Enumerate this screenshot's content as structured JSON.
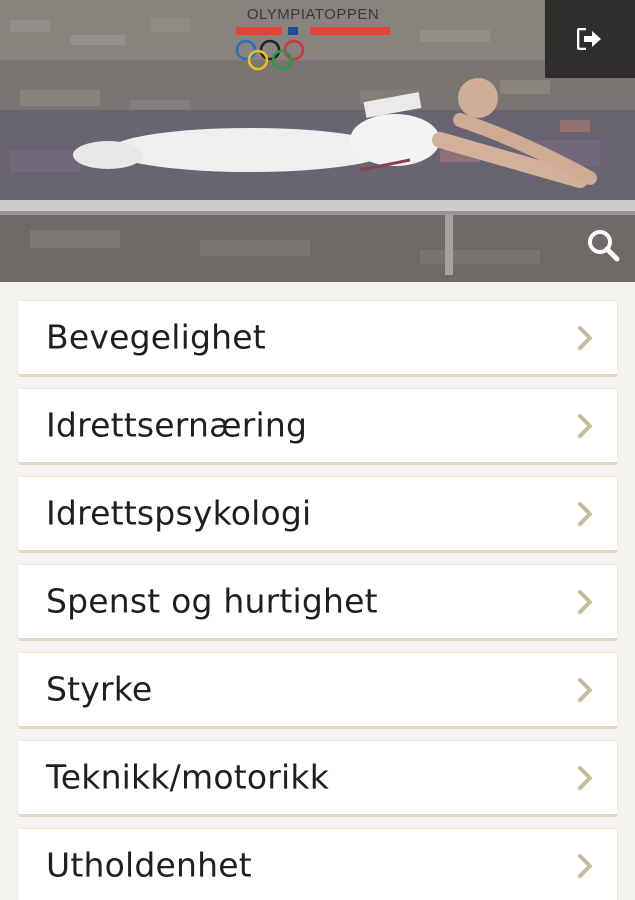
{
  "header": {
    "brand_text": "OLYMPIATOPPEN",
    "exit_icon": "sign-out-icon",
    "search_icon": "search-icon",
    "colors": {
      "stripe_red": "#e8413a",
      "stripe_blue": "#1f4e9c",
      "exit_bg": "#2f2e2c"
    }
  },
  "menu": {
    "items": [
      {
        "label": "Bevegelighet"
      },
      {
        "label": "Idrettsernæring"
      },
      {
        "label": "Idrettspsykologi"
      },
      {
        "label": "Spenst og hurtighet"
      },
      {
        "label": "Styrke"
      },
      {
        "label": "Teknikk/motorikk"
      },
      {
        "label": "Utholdenhet"
      }
    ],
    "chevron_icon": "chevron-right-icon",
    "colors": {
      "item_border": "#e0d8bf",
      "chevron": "#c8bc96"
    }
  }
}
